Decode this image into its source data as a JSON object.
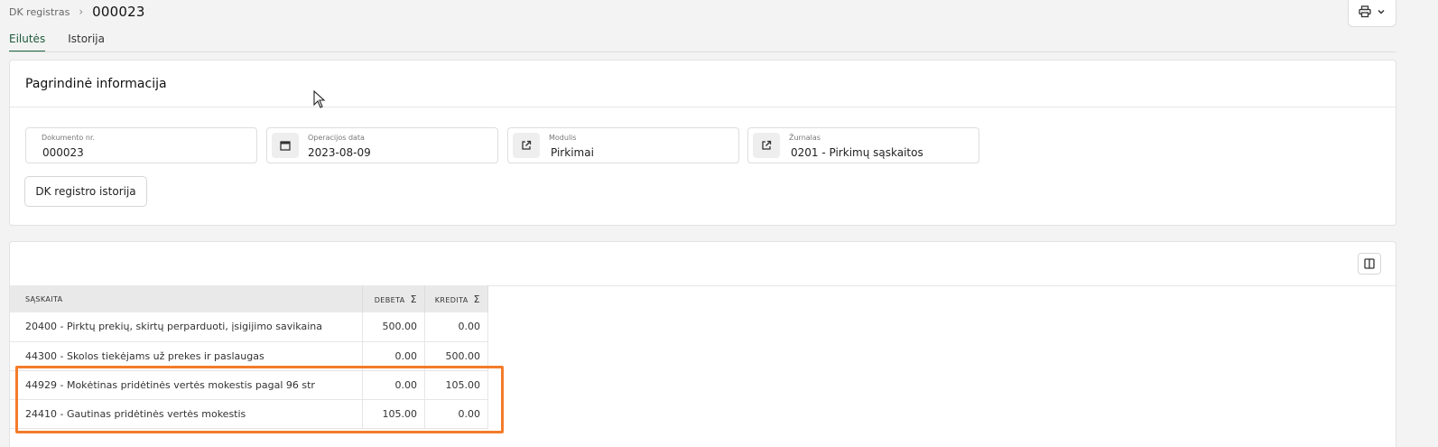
{
  "breadcrumb": {
    "parent": "DK registras",
    "current": "000023"
  },
  "tabs": [
    {
      "label": "Eilutės"
    },
    {
      "label": "Istorija"
    }
  ],
  "main_info": {
    "title": "Pagrindinė informacija",
    "document_no": {
      "label": "Dokumento nr.",
      "value": "000023"
    },
    "operation_date": {
      "label": "Operacijos data",
      "value": "2023-08-09"
    },
    "module": {
      "label": "Modulis",
      "value": "Pirkimai"
    },
    "journal": {
      "label": "Žurnalas",
      "value": "0201 - Pirkimų sąskaitos"
    },
    "history_button": "DK registro istorija"
  },
  "table": {
    "headers": {
      "account": "SĄSKAITA",
      "debit": "DEBETA",
      "credit": "KREDITA"
    },
    "rows": [
      {
        "account": "20400 - Pirktų prekių, skirtų perparduoti, įsigijimo savikaina",
        "debit": "500.00",
        "credit": "0.00"
      },
      {
        "account": "44300 - Skolos tiekėjams už prekes ir paslaugas",
        "debit": "0.00",
        "credit": "500.00"
      },
      {
        "account": "44929 - Mokėtinas pridėtinės vertės mokestis pagal 96 str",
        "debit": "0.00",
        "credit": "105.00"
      },
      {
        "account": "24410 - Gautinas pridėtinės vertės mokestis",
        "debit": "105.00",
        "credit": "0.00"
      }
    ]
  },
  "colors": {
    "accent": "#1d6b45",
    "highlight": "#f47c2a"
  }
}
